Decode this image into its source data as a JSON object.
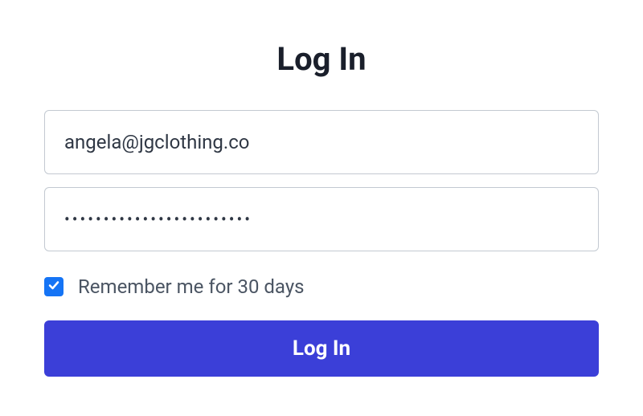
{
  "form": {
    "title": "Log In",
    "email_value": "angela@jgclothing.co",
    "password_value": "••••••••••••••••••••••••",
    "remember_checked": true,
    "remember_label": "Remember me for 30 days",
    "submit_label": "Log In"
  }
}
